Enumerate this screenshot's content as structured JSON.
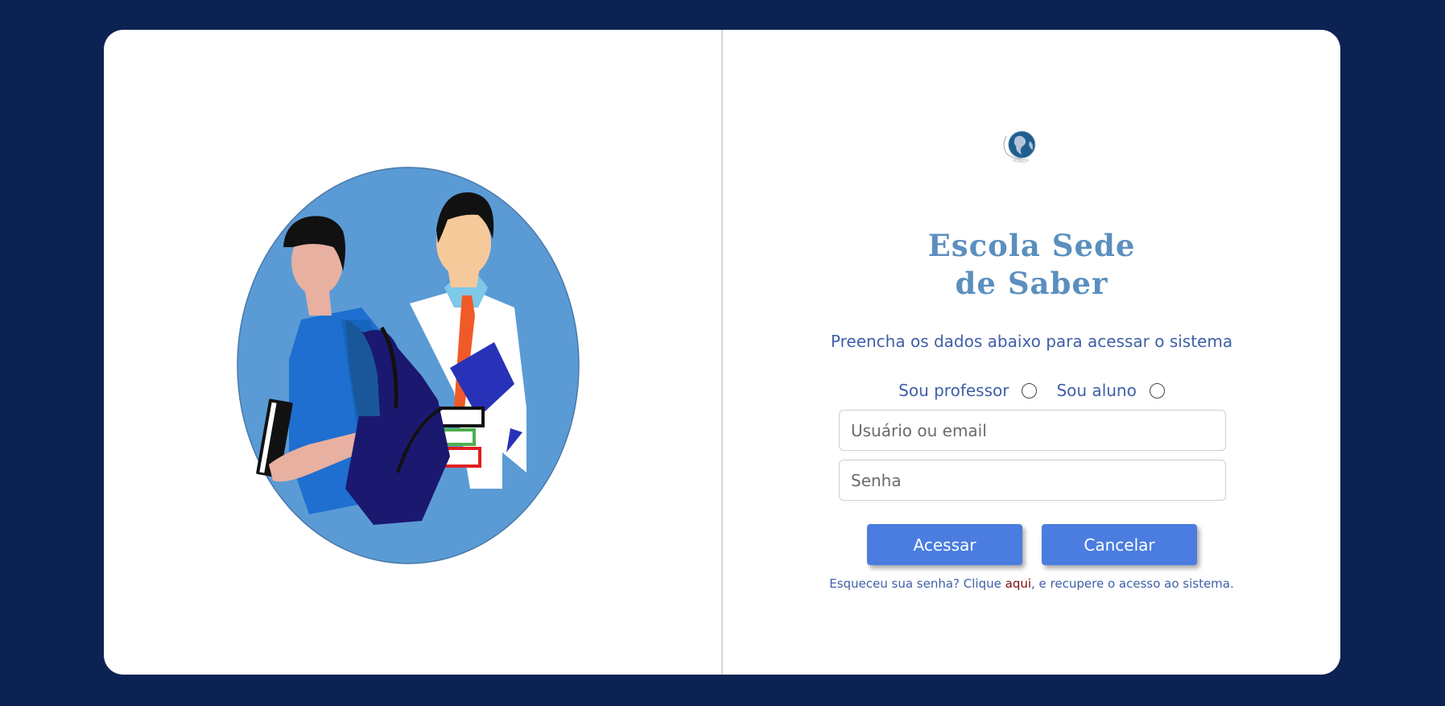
{
  "colors": {
    "background": "#0b2253",
    "card": "#ffffff",
    "accent_text": "#3f5fa8",
    "button": "#4a7ddf",
    "link": "#7a0c0c",
    "logo_text": "#5b8fbf"
  },
  "illustration": {
    "icon": "student-and-teacher-illustration"
  },
  "logo": {
    "icon": "globe-logo-icon",
    "line1": "Escola Sede",
    "line2": "de Saber"
  },
  "form": {
    "subtitle": "Preencha os dados abaixo para acessar o sistema",
    "role_professor_label": "Sou professor",
    "role_aluno_label": "Sou aluno",
    "username_placeholder": "Usuário ou email",
    "username_value": "",
    "password_placeholder": "Senha",
    "password_value": "",
    "submit_label": "Acessar",
    "cancel_label": "Cancelar",
    "forgot_prefix": "Esqueceu sua senha? Clique ",
    "forgot_link": "aqui",
    "forgot_suffix": ", e recupere o acesso ao sistema."
  }
}
